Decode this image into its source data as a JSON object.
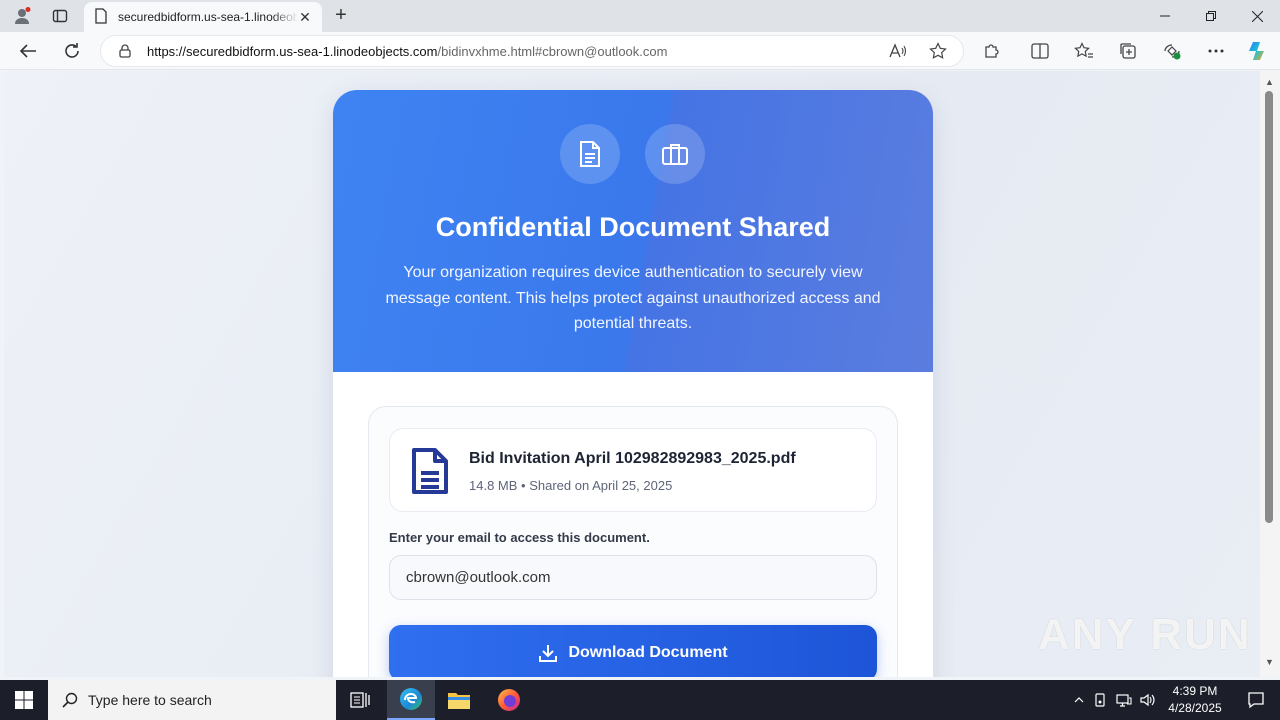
{
  "browser": {
    "tab_title": "securedbidform.us-sea-1.linodeobjects.com",
    "tab_close": "✕",
    "new_tab": "+",
    "url_host": "https://securedbidform.us-sea-1.linodeobjects.com",
    "url_path": "/bidinvxhme.html#cbrown@outlook.com"
  },
  "hero": {
    "title": "Confidential Document Shared",
    "subtitle": "Your organization requires device authentication to securely view message content. This helps protect against unauthorized access and potential threats."
  },
  "file": {
    "name": "Bid Invitation April 102982892983_2025.pdf",
    "meta": "14.8 MB • Shared on April 25, 2025"
  },
  "form": {
    "email_label": "Enter your email to access this document.",
    "email_value": "cbrown@outlook.com",
    "download_label": "Download Document"
  },
  "watermark": "ANY RUN",
  "taskbar": {
    "search_placeholder": "Type here to search",
    "time": "4:39 PM",
    "date": "4/28/2025"
  },
  "colors": {
    "accent": "#3f83f2",
    "button": "#1e55d8"
  }
}
